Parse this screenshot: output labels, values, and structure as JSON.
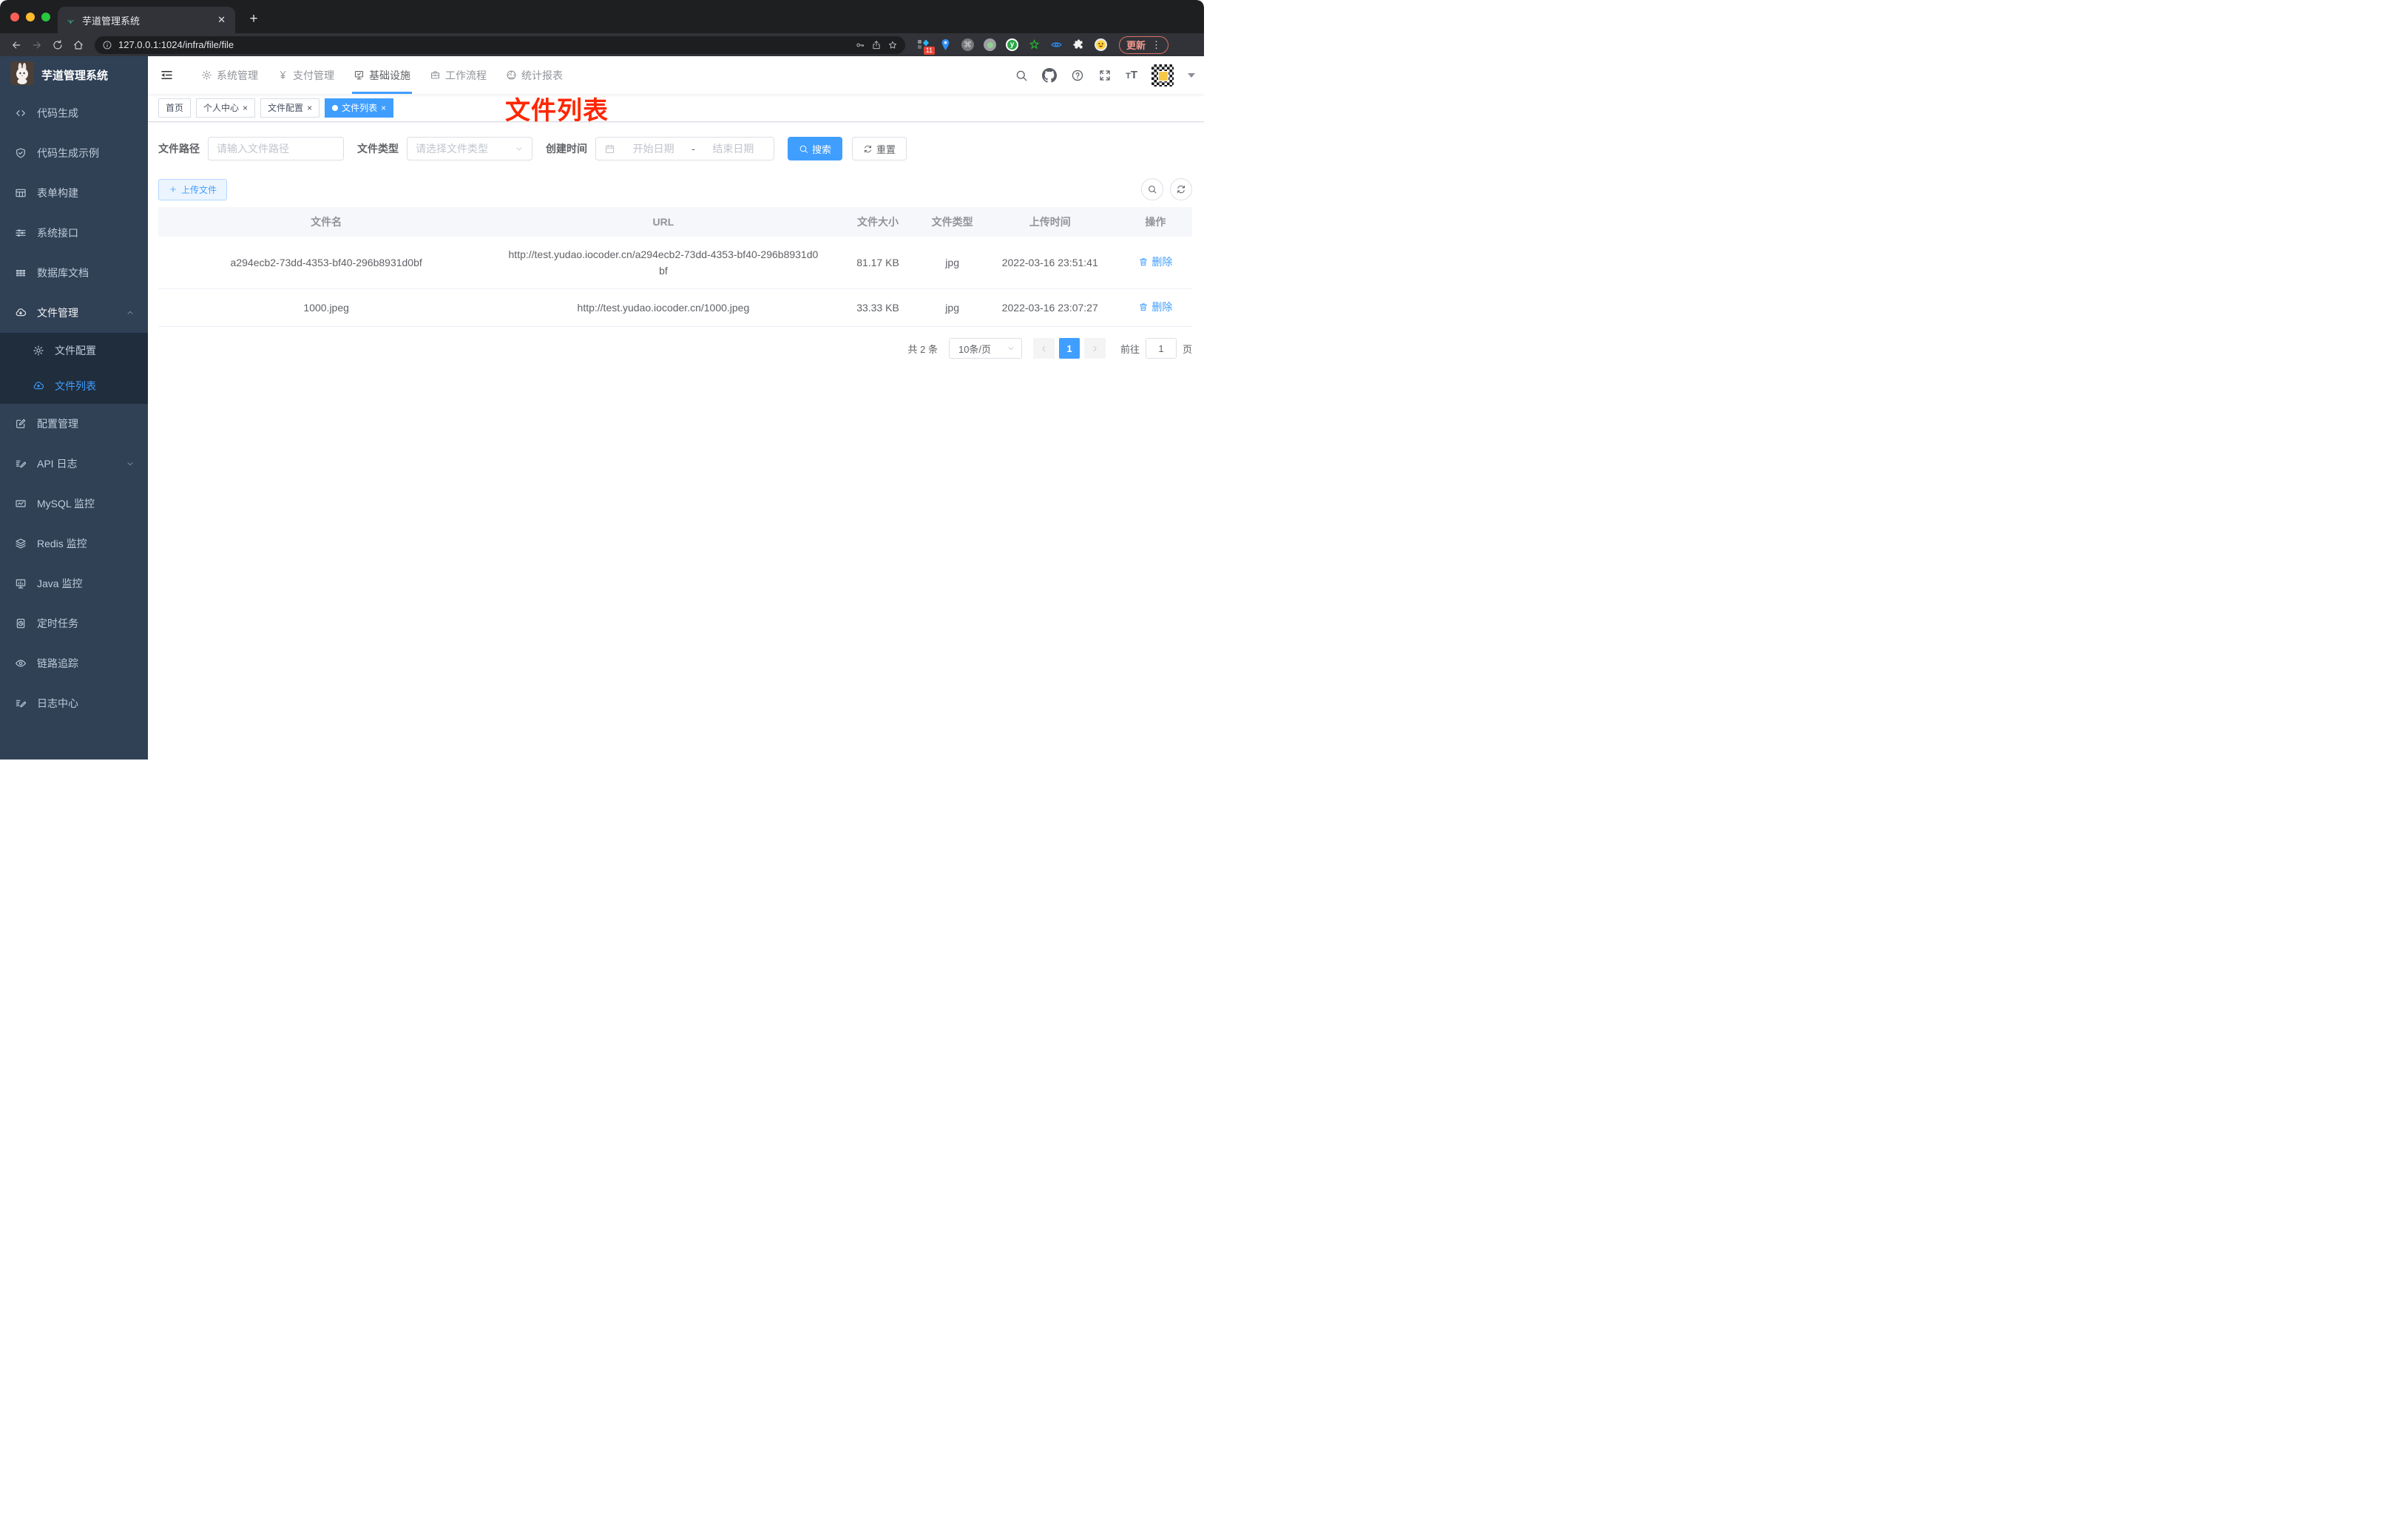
{
  "browser": {
    "tab_title": "芋道管理系统",
    "close_glyph": "✕",
    "new_tab_glyph": "+",
    "url": "127.0.0.1:1024/infra/file/file",
    "extension_badge": "11",
    "update_label": "更新",
    "menu_dots": "⋮"
  },
  "sidebar": {
    "app_title": "芋道管理系统",
    "menu": [
      {
        "icon": "code",
        "label": "代码生成"
      },
      {
        "icon": "shield-check",
        "label": "代码生成示例"
      },
      {
        "icon": "form-grid",
        "label": "表单构建"
      },
      {
        "icon": "sliders",
        "label": "系统接口"
      },
      {
        "icon": "table-solid",
        "label": "数据库文档"
      },
      {
        "icon": "cloud-download",
        "label": "文件管理",
        "chevron": "up",
        "open": true,
        "children": [
          {
            "icon": "gear",
            "label": "文件配置",
            "active": false
          },
          {
            "icon": "cloud-upload",
            "label": "文件列表",
            "active": true
          }
        ]
      },
      {
        "icon": "edit-square",
        "label": "配置管理"
      },
      {
        "icon": "log-lines",
        "label": "API 日志",
        "chevron": "down"
      },
      {
        "icon": "chart-monitor",
        "label": "MySQL 监控"
      },
      {
        "icon": "layers",
        "label": "Redis 监控"
      },
      {
        "icon": "pc-monitor",
        "label": "Java 监控"
      },
      {
        "icon": "timer-doc",
        "label": "定时任务"
      },
      {
        "icon": "eye",
        "label": "链路追踪"
      },
      {
        "icon": "log-lines",
        "label": "日志中心"
      }
    ]
  },
  "topnav": {
    "items": [
      {
        "icon": "gear",
        "label": "系统管理",
        "active": false
      },
      {
        "icon": "yen",
        "label": "支付管理",
        "active": false
      },
      {
        "icon": "monitor-check",
        "label": "基础设施",
        "active": true
      },
      {
        "icon": "briefcase",
        "label": "工作流程",
        "active": false
      },
      {
        "icon": "gauge",
        "label": "统计报表",
        "active": false
      }
    ]
  },
  "tags": {
    "items": [
      {
        "label": "首页",
        "closable": false,
        "active": false
      },
      {
        "label": "个人中心",
        "closable": true,
        "active": false
      },
      {
        "label": "文件配置",
        "closable": true,
        "active": false
      },
      {
        "label": "文件列表",
        "closable": true,
        "active": true
      }
    ],
    "close_glyph": "×"
  },
  "annotation": "文件列表",
  "filter": {
    "path_label": "文件路径",
    "path_placeholder": "请输入文件路径",
    "type_label": "文件类型",
    "type_placeholder": "请选择文件类型",
    "time_label": "创建时间",
    "start_placeholder": "开始日期",
    "date_separator": "-",
    "end_placeholder": "结束日期",
    "search_label": "搜索",
    "reset_label": "重置"
  },
  "actions": {
    "upload_label": "上传文件"
  },
  "table": {
    "columns": [
      "文件名",
      "URL",
      "文件大小",
      "文件类型",
      "上传时间",
      "操作"
    ],
    "col_widths": [
      "32.5%",
      "32.7%",
      "8.8%",
      "5.6%",
      "13.3%",
      "7.1%"
    ],
    "delete_label": "删除",
    "rows": [
      {
        "name": "a294ecb2-73dd-4353-bf40-296b8931d0bf",
        "url": "http://test.yudao.iocoder.cn/a294ecb2-73dd-4353-bf40-296b8931d0bf",
        "size": "81.17 KB",
        "type": "jpg",
        "time": "2022-03-16 23:51:41"
      },
      {
        "name": "1000.jpeg",
        "url": "http://test.yudao.iocoder.cn/1000.jpeg",
        "size": "33.33 KB",
        "type": "jpg",
        "time": "2022-03-16 23:07:27"
      }
    ]
  },
  "pagination": {
    "total": "共 2 条",
    "page_size": "10条/页",
    "current_page": "1",
    "goto_label": "前往",
    "goto_value": "1",
    "page_unit": "页"
  }
}
